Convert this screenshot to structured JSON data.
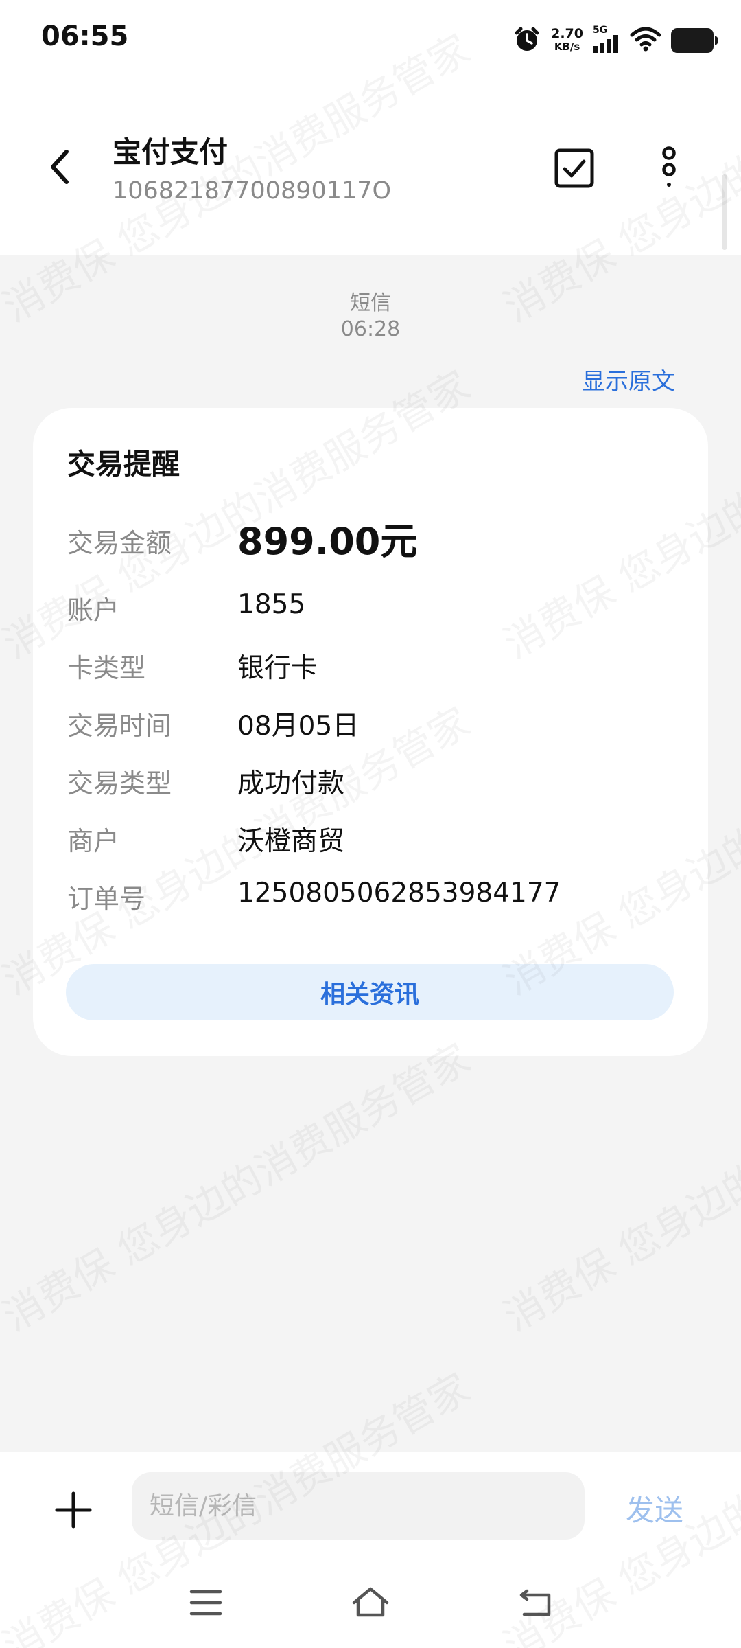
{
  "status_bar": {
    "time": "06:55",
    "net_speed_value": "2.70",
    "net_speed_unit": "KB/s",
    "network": "5G",
    "icons": [
      "alarm-icon",
      "signal-icon",
      "wifi-icon",
      "battery-icon"
    ]
  },
  "header": {
    "sender_name": "宝付支付",
    "sender_number": "10682187700890117O",
    "icons": [
      "back-arrow-icon",
      "checkbox-icon",
      "more-vertical-icon"
    ]
  },
  "message": {
    "type_label": "短信",
    "time": "06:28",
    "show_original": "显示原文",
    "card": {
      "title": "交易提醒",
      "rows": [
        {
          "label": "交易金额",
          "value": "899.00元"
        },
        {
          "label": "账户",
          "value": "1855"
        },
        {
          "label": "卡类型",
          "value": "银行卡"
        },
        {
          "label": "交易时间",
          "value": "08月05日"
        },
        {
          "label": "交易类型",
          "value": "成功付款"
        },
        {
          "label": "商户",
          "value": "沃橙商贸"
        },
        {
          "label": "订单号",
          "value": "1250805062853984177"
        }
      ],
      "action_label": "相关资讯"
    }
  },
  "composer": {
    "placeholder": "短信/彩信",
    "value": "",
    "send_label": "发送",
    "icons": [
      "add-icon"
    ]
  },
  "nav_bar": {
    "icons": [
      "menu-icon",
      "home-icon",
      "back-icon"
    ]
  },
  "watermark": {
    "texts": [
      "消费保 您身边的消费服务管家"
    ]
  },
  "colors": {
    "accent": "#2a6fdb",
    "accent_light_bg": "#e6f1fc",
    "send_disabled": "#9ec0ee",
    "page_bg": "#f4f4f4"
  }
}
